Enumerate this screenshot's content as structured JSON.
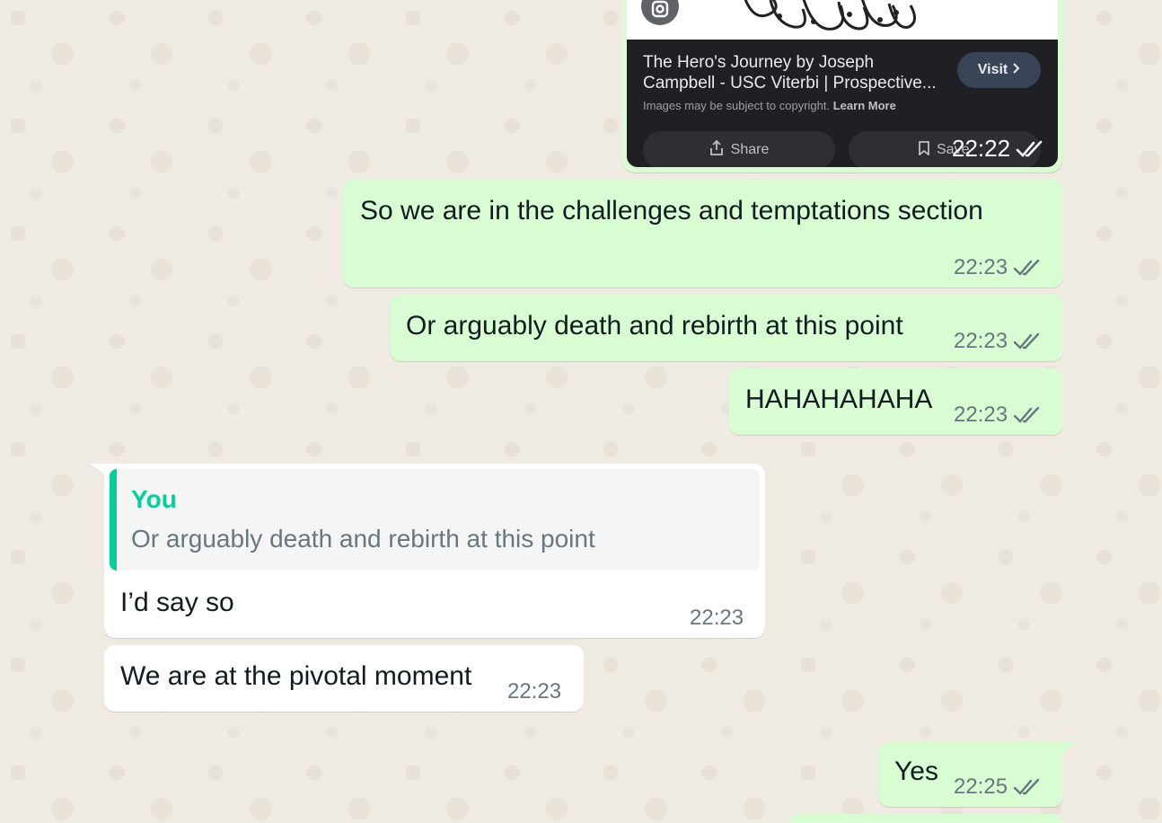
{
  "colors": {
    "outgoing_bubble": "#d9fdd3",
    "incoming_bubble": "#ffffff",
    "chat_background": "#efeae2",
    "quote_accent": "#06cf9c",
    "read_tick": "#667781"
  },
  "image_card": {
    "title_line1": "The Hero's Journey by Joseph",
    "title_line2": "Campbell - USC Viterbi | Prospective...",
    "copyright_text": "Images may be subject to copyright.",
    "learn_more": "Learn More",
    "visit_label": "Visit",
    "share_label": "Share",
    "save_label": "Save",
    "time": "22:22",
    "status_icon": "double-check-read"
  },
  "messages": [
    {
      "direction": "outgoing",
      "text": "So we are in the challenges and temptations section",
      "time": "22:23",
      "status_icon": "double-check-read"
    },
    {
      "direction": "outgoing",
      "text": "Or arguably death and rebirth at this point",
      "time": "22:23",
      "status_icon": "double-check-read"
    },
    {
      "direction": "outgoing",
      "text": "HAHAHAHAHA",
      "time": "22:23",
      "status_icon": "double-check-read"
    },
    {
      "direction": "incoming",
      "quote_author": "You",
      "quote_text": "Or arguably death and rebirth at this point",
      "text": "I’d say so",
      "time": "22:23"
    },
    {
      "direction": "incoming",
      "text": "We are at the pivotal moment",
      "time": "22:23"
    },
    {
      "direction": "outgoing",
      "text": "Yes",
      "time": "22:25",
      "status_icon": "double-check-read"
    }
  ]
}
